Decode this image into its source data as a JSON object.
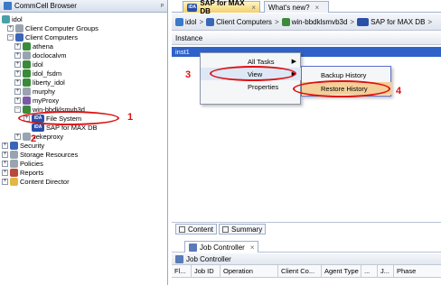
{
  "left_pane": {
    "title": "CommCell Browser",
    "pin": "ᵖ"
  },
  "tree": [
    {
      "label": "idol",
      "icon": "commcell-icon"
    },
    {
      "label": "Client Computer Groups",
      "icon": "group-icon"
    },
    {
      "label": "Client Computers",
      "icon": "computer-icon"
    },
    {
      "label": "athena",
      "icon": "client-icon"
    },
    {
      "label": "doclocalvm",
      "icon": "client-icon"
    },
    {
      "label": "idol",
      "icon": "client-icon"
    },
    {
      "label": "idol_fsdm",
      "icon": "client-icon"
    },
    {
      "label": "liberty_idol",
      "icon": "client-icon"
    },
    {
      "label": "murphy",
      "icon": "client-icon"
    },
    {
      "label": "myProxy",
      "icon": "client-icon"
    },
    {
      "label": "win-bbdklsmvb3d",
      "icon": "client-icon"
    },
    {
      "label": "File System",
      "icon": "ida-icon"
    },
    {
      "label": "SAP for MAX DB",
      "icon": "ida-icon"
    },
    {
      "label": "zekeproxy",
      "icon": "client-icon"
    },
    {
      "label": "Security",
      "icon": "security-icon"
    },
    {
      "label": "Storage Resources",
      "icon": "storage-icon"
    },
    {
      "label": "Policies",
      "icon": "policies-icon"
    },
    {
      "label": "Reports",
      "icon": "reports-icon"
    },
    {
      "label": "Content Director",
      "icon": "content-director-icon"
    }
  ],
  "tabs": [
    {
      "label": "SAP for MAX DB",
      "badge": "iDA",
      "close": "×"
    },
    {
      "label": "What's new?",
      "close": "×"
    }
  ],
  "breadcrumb": {
    "items": [
      "idol",
      "Client Computers",
      "win-bbdklsmvb3d",
      "SAP for MAX DB"
    ],
    "sep": ">"
  },
  "table": {
    "column": "Instance",
    "row": "inst1"
  },
  "context_menu": {
    "items": [
      "All Tasks",
      "View",
      "Properties"
    ],
    "arrow": "▶"
  },
  "submenu": {
    "items": [
      "Backup History",
      "Restore History"
    ]
  },
  "annotations": [
    "1",
    "2",
    "3",
    "4"
  ],
  "bottom_tabs": [
    "Content",
    "Summary"
  ],
  "job_controller": {
    "tab": "Job Controller",
    "close": "×",
    "header": "Job Controller",
    "columns": [
      "Fl...",
      "Job ID",
      "Operation",
      "Client Co...",
      "Agent Type",
      "...",
      "J...",
      "Phase"
    ]
  },
  "colors": {
    "selection": "#2f62c8",
    "annotation": "#dd1111",
    "active_tab": "#f3d06a"
  }
}
